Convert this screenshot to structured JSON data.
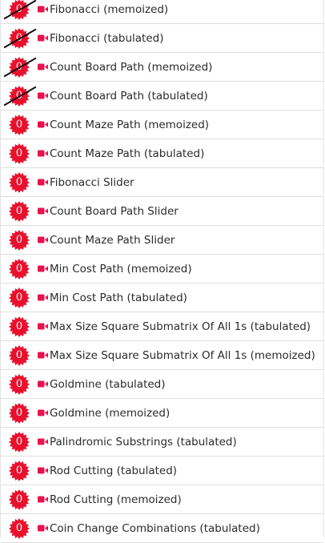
{
  "colors": {
    "badge": "#e8112d",
    "video_icon": "#e8124e",
    "text": "#2b2b2b",
    "divider": "#dedede"
  },
  "icons": {
    "badge": "starburst-badge-icon",
    "video": "video-camera-icon",
    "crossed": "slash-mark-icon"
  },
  "items": [
    {
      "title": "Fibonacci (memoized)",
      "count": "0",
      "crossed": true
    },
    {
      "title": "Fibonacci (tabulated)",
      "count": "0",
      "crossed": true
    },
    {
      "title": "Count Board Path (memoized)",
      "count": "0",
      "crossed": true
    },
    {
      "title": "Count Board Path (tabulated)",
      "count": "0",
      "crossed": true
    },
    {
      "title": "Count Maze Path (memoized)",
      "count": "0",
      "crossed": false
    },
    {
      "title": "Count Maze Path (tabulated)",
      "count": "0",
      "crossed": false
    },
    {
      "title": "Fibonacci Slider",
      "count": "0",
      "crossed": false
    },
    {
      "title": "Count Board Path Slider",
      "count": "0",
      "crossed": false
    },
    {
      "title": "Count Maze Path Slider",
      "count": "0",
      "crossed": false
    },
    {
      "title": "Min Cost Path (memoized)",
      "count": "0",
      "crossed": false
    },
    {
      "title": "Min Cost Path (tabulated)",
      "count": "0",
      "crossed": false
    },
    {
      "title": "Max Size Square Submatrix Of All 1s (tabulated)",
      "count": "0",
      "crossed": false
    },
    {
      "title": "Max Size Square Submatrix Of All 1s (memoized)",
      "count": "0",
      "crossed": false
    },
    {
      "title": "Goldmine (tabulated)",
      "count": "0",
      "crossed": false
    },
    {
      "title": "Goldmine (memoized)",
      "count": "0",
      "crossed": false
    },
    {
      "title": "Palindromic Substrings (tabulated)",
      "count": "0",
      "crossed": false
    },
    {
      "title": "Rod Cutting (tabulated)",
      "count": "0",
      "crossed": false
    },
    {
      "title": "Rod Cutting (memoized)",
      "count": "0",
      "crossed": false
    },
    {
      "title": "Coin Change Combinations (tabulated)",
      "count": "0",
      "crossed": false
    }
  ]
}
